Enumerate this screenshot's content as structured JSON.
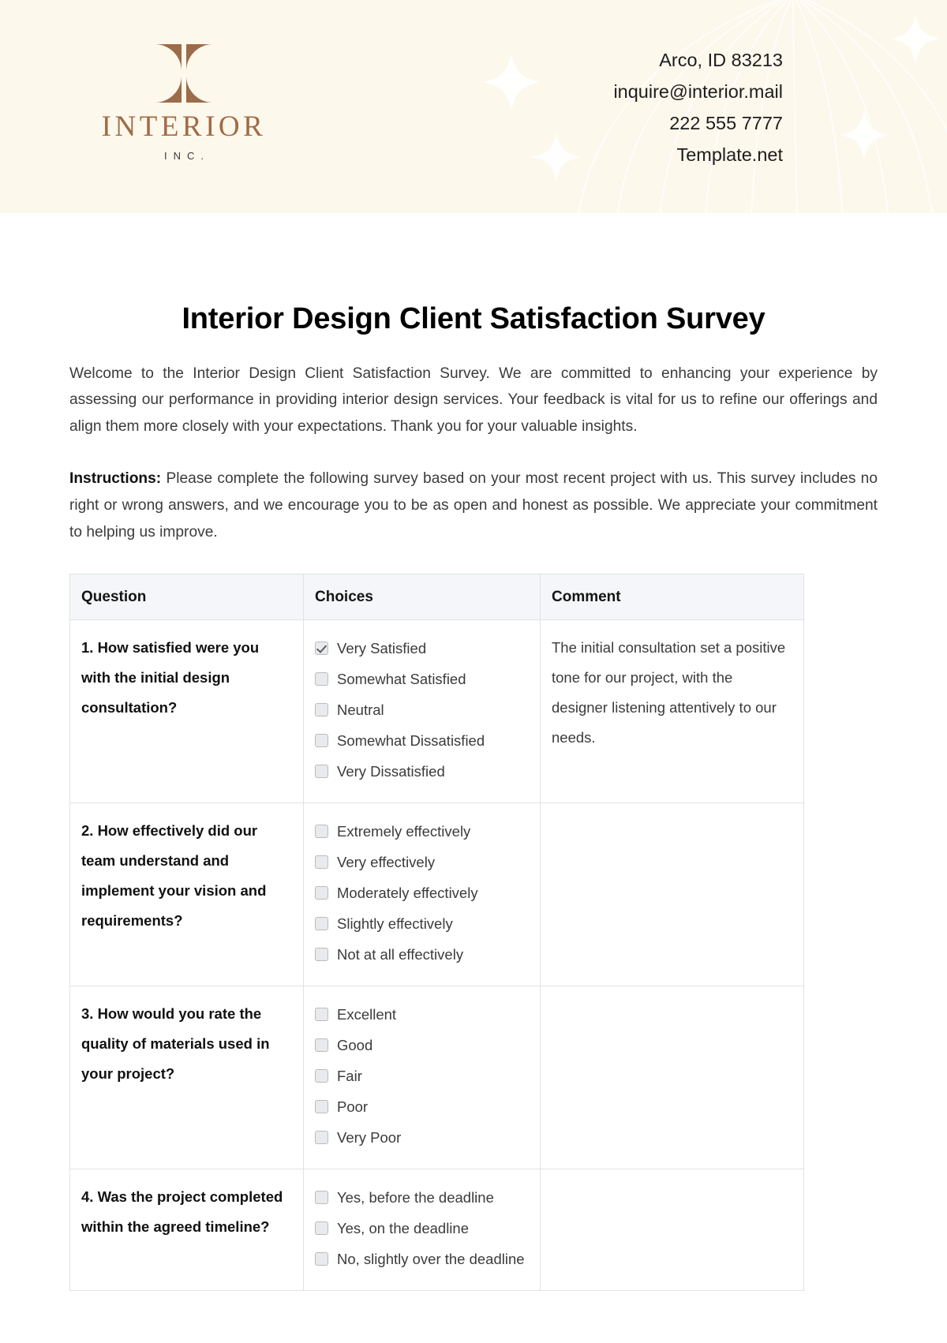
{
  "brand": {
    "name": "INTERIOR",
    "suffix": "INC.",
    "accent_color": "#A06B47",
    "header_bg": "#FDF8EC"
  },
  "contact": {
    "lines": [
      "Arco, ID 83213",
      "inquire@interior.mail",
      "222 555 7777",
      "Template.net"
    ]
  },
  "document": {
    "title": "Interior Design Client Satisfaction Survey",
    "intro": "Welcome to the Interior Design Client Satisfaction Survey. We are committed to enhancing your experience by assessing our performance in providing interior design services. Your feedback is vital for us to refine our offerings and align them more closely with your expectations. Thank you for your valuable insights.",
    "instructions_label": "Instructions:",
    "instructions_text": " Please complete the following survey based on your most recent project with us. This survey includes no right or wrong answers, and we encourage you to be as open and honest as possible. We appreciate your commitment to helping us improve."
  },
  "table": {
    "headers": [
      "Question",
      "Choices",
      "Comment"
    ],
    "rows": [
      {
        "question": "1. How satisfied were you with the initial design consultation?",
        "choices": [
          {
            "label": "Very Satisfied",
            "checked": true
          },
          {
            "label": "Somewhat Satisfied",
            "checked": false
          },
          {
            "label": "Neutral",
            "checked": false
          },
          {
            "label": "Somewhat Dissatisfied",
            "checked": false
          },
          {
            "label": "Very Dissatisfied",
            "checked": false
          }
        ],
        "comment": "The initial consultation set a positive tone for our project, with the designer listening attentively to our needs."
      },
      {
        "question": "2. How effectively did our team understand and implement your vision and requirements?",
        "choices": [
          {
            "label": "Extremely effectively",
            "checked": false
          },
          {
            "label": "Very effectively",
            "checked": false
          },
          {
            "label": "Moderately effectively",
            "checked": false
          },
          {
            "label": "Slightly effectively",
            "checked": false
          },
          {
            "label": "Not at all effectively",
            "checked": false
          }
        ],
        "comment": ""
      },
      {
        "question": "3. How would you rate the quality of materials used in your project?",
        "choices": [
          {
            "label": "Excellent",
            "checked": false
          },
          {
            "label": "Good",
            "checked": false
          },
          {
            "label": "Fair",
            "checked": false
          },
          {
            "label": "Poor",
            "checked": false
          },
          {
            "label": "Very Poor",
            "checked": false
          }
        ],
        "comment": ""
      },
      {
        "question": "4. Was the project completed within the agreed timeline?",
        "choices": [
          {
            "label": "Yes, before the deadline",
            "checked": false
          },
          {
            "label": "Yes, on the deadline",
            "checked": false
          },
          {
            "label": "No, slightly over the deadline",
            "checked": false
          }
        ],
        "comment": ""
      }
    ]
  }
}
